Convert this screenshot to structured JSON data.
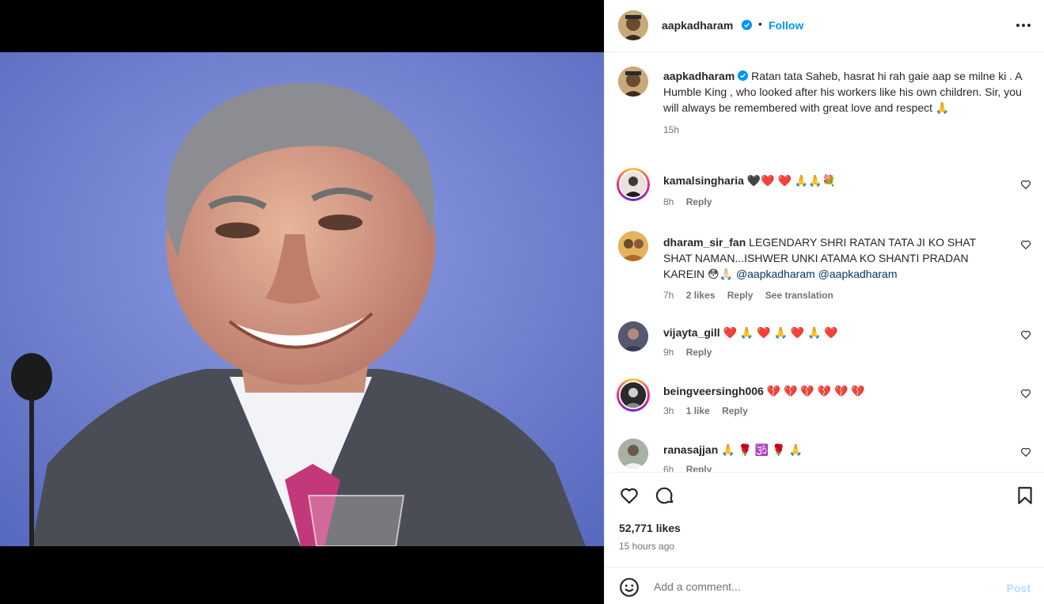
{
  "post": {
    "username": "aapkadharam",
    "follow_label": "Follow",
    "separator": "•",
    "caption": "Ratan tata Saheb, hasrat hi rah gaie aap se milne ki . A Humble King , who looked after his workers like his own children. Sir, you will always be remembered with great love and respect 🙏",
    "caption_time": "15h",
    "likes": "52,771 likes",
    "time_ago": "15 hours ago",
    "comment_placeholder": "Add a comment...",
    "post_label": "Post"
  },
  "comments": [
    {
      "user": "kamalsingharia",
      "text": "🖤❤️ ❤️ 🙏🙏💐",
      "time": "8h",
      "likes": "",
      "reply": "Reply",
      "translate": ""
    },
    {
      "user": "dharam_sir_fan",
      "text": "LEGENDARY SHRI RATAN TATA JI KO SHAT SHAT NAMAN...ISHWER UNKI ATAMA KO SHANTI PRADAN KAREIN 😳🙏🏻 ",
      "mention1": "@aapkadharam",
      "mention2": "@aapkadharam",
      "time": "7h",
      "likes": "2 likes",
      "reply": "Reply",
      "translate": "See translation"
    },
    {
      "user": "vijayta_gill",
      "text": "❤️ 🙏 ❤️ 🙏 ❤️ 🙏 ❤️",
      "time": "9h",
      "likes": "",
      "reply": "Reply",
      "translate": ""
    },
    {
      "user": "beingveersingh006",
      "text": "💔 💔 💔 💔 💔 💔",
      "time": "3h",
      "likes": "1 like",
      "reply": "Reply",
      "translate": ""
    },
    {
      "user": "ranasajjan",
      "text": "🙏 🌹 🕉️ 🌹 🙏",
      "time": "6h",
      "likes": "",
      "reply": "Reply",
      "translate": ""
    }
  ],
  "colors": {
    "accent": "#0095f6",
    "verified": "#0095f6",
    "muted": "#737373",
    "post_disabled": "#b3dbff"
  },
  "icons": [
    "verified-badge-icon",
    "more-options-icon",
    "heart-icon",
    "comment-icon",
    "bookmark-icon",
    "emoji-icon"
  ]
}
